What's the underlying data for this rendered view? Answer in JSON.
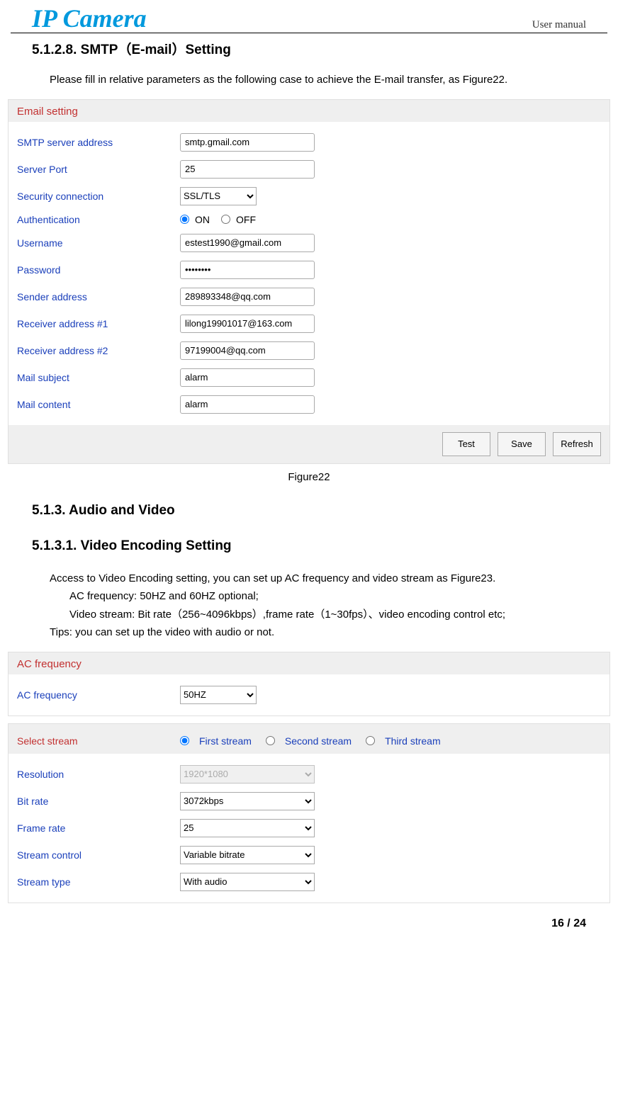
{
  "header": {
    "logo": "IP Camera",
    "manual": "User manual"
  },
  "sections": {
    "smtp_title": "5.1.2.8. SMTP（E-mail）Setting",
    "smtp_intro": "Please fill in relative parameters as the following case to achieve the E-mail transfer, as Figure22.",
    "audio_video_title": "5.1.3.  Audio and Video",
    "video_encoding_title": "5.1.3.1. Video Encoding Setting",
    "video_intro_1": "Access to Video Encoding setting, you can set up AC frequency and video stream as Figure23.",
    "video_intro_2": "AC frequency: 50HZ and 60HZ optional;",
    "video_intro_3": "Video stream: Bit rate（256~4096kbps）,frame rate（1~30fps）、video encoding control etc;",
    "video_intro_4": "Tips: you can set up the video with audio or not."
  },
  "figure22_caption": "Figure22",
  "email_panel": {
    "title": "Email setting",
    "labels": {
      "smtp_server": "SMTP server address",
      "server_port": "Server Port",
      "security": "Security connection",
      "auth": "Authentication",
      "on": "ON",
      "off": "OFF",
      "username": "Username",
      "password": "Password",
      "sender": "Sender address",
      "recv1": "Receiver address #1",
      "recv2": "Receiver address #2",
      "subject": "Mail subject",
      "content": "Mail content"
    },
    "values": {
      "smtp_server": "smtp.gmail.com",
      "server_port": "25",
      "security": "SSL/TLS",
      "username": "estest1990@gmail.com",
      "password": "••••••••",
      "sender": "289893348@qq.com",
      "recv1": "lilong19901017@163.com",
      "recv2": "97199004@qq.com",
      "subject": "alarm",
      "content": "alarm"
    },
    "buttons": {
      "test": "Test",
      "save": "Save",
      "refresh": "Refresh"
    }
  },
  "ac_panel": {
    "title": "AC frequency",
    "label": "AC frequency",
    "value": "50HZ"
  },
  "stream_panel": {
    "title": "Select stream",
    "options": {
      "first": "First stream",
      "second": "Second stream",
      "third": "Third stream"
    },
    "labels": {
      "resolution": "Resolution",
      "bitrate": "Bit rate",
      "framerate": "Frame rate",
      "control": "Stream control",
      "type": "Stream type"
    },
    "values": {
      "resolution": "1920*1080",
      "bitrate": "3072kbps",
      "framerate": "25",
      "control": "Variable bitrate",
      "type": "With audio"
    }
  },
  "page_number": "16 / 24"
}
